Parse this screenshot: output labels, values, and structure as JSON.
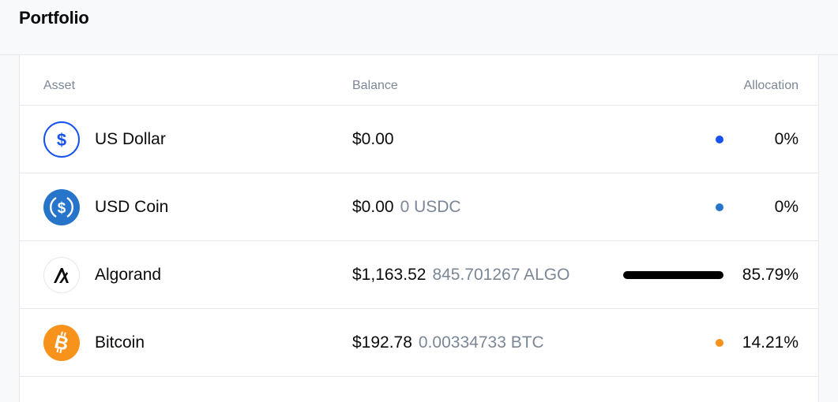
{
  "header": {
    "title": "Portfolio"
  },
  "table": {
    "columns": {
      "asset": "Asset",
      "balance": "Balance",
      "allocation": "Allocation"
    },
    "rows": [
      {
        "name": "US Dollar",
        "fiat": "$0.00",
        "crypto": "",
        "allocation": "0%",
        "allocation_fraction": 0.0,
        "color": "#1652f0",
        "icon": "usd-icon"
      },
      {
        "name": "USD Coin",
        "fiat": "$0.00",
        "crypto": "0 USDC",
        "allocation": "0%",
        "allocation_fraction": 0.0,
        "color": "#2775ca",
        "icon": "usdc-icon"
      },
      {
        "name": "Algorand",
        "fiat": "$1,163.52",
        "crypto": "845.701267 ALGO",
        "allocation": "85.79%",
        "allocation_fraction": 0.8579,
        "color": "#000000",
        "icon": "algorand-icon"
      },
      {
        "name": "Bitcoin",
        "fiat": "$192.78",
        "crypto": "0.00334733 BTC",
        "allocation": "14.21%",
        "allocation_fraction": 0.1421,
        "color": "#f7931a",
        "icon": "bitcoin-icon"
      }
    ]
  }
}
